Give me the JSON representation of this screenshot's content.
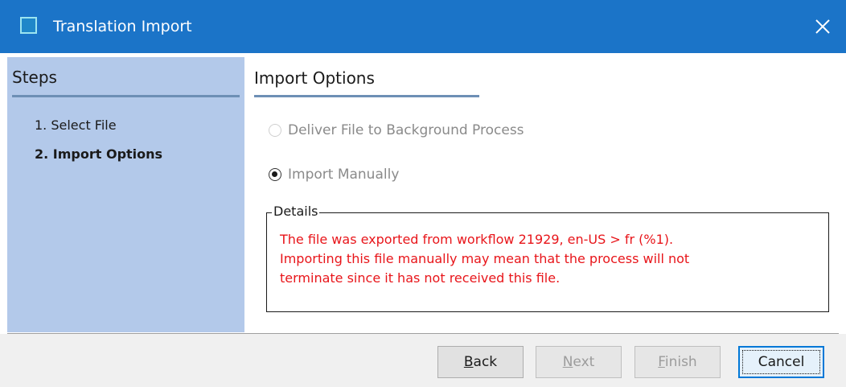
{
  "window": {
    "title": "Translation Import",
    "accent_color": "#1b74c8",
    "icon": "app-window-icon",
    "close_icon": "close-icon"
  },
  "steps": {
    "header": "Steps",
    "items": [
      {
        "label": "1. Select File",
        "active": false
      },
      {
        "label": "2. Import Options",
        "active": true
      }
    ]
  },
  "options": {
    "header": "Import Options",
    "radios": [
      {
        "label": "Deliver File to Background Process",
        "checked": false,
        "enabled": false
      },
      {
        "label": "Import Manually",
        "checked": true,
        "enabled": true
      }
    ],
    "details": {
      "legend": "Details",
      "message_color": "#e8151a",
      "lines": [
        "The file was exported from workflow 21929, en-US > fr (%1).",
        "Importing this file manually may mean that the process will not",
        "terminate since it has not received this file."
      ]
    }
  },
  "buttons": {
    "back": {
      "mnemonic": "B",
      "rest": "ack",
      "enabled": true
    },
    "next": {
      "mnemonic": "N",
      "rest": "ext",
      "enabled": false
    },
    "finish": {
      "mnemonic": "F",
      "rest": "inish",
      "enabled": false
    },
    "cancel": {
      "label": "Cancel",
      "enabled": true,
      "default": true
    }
  }
}
